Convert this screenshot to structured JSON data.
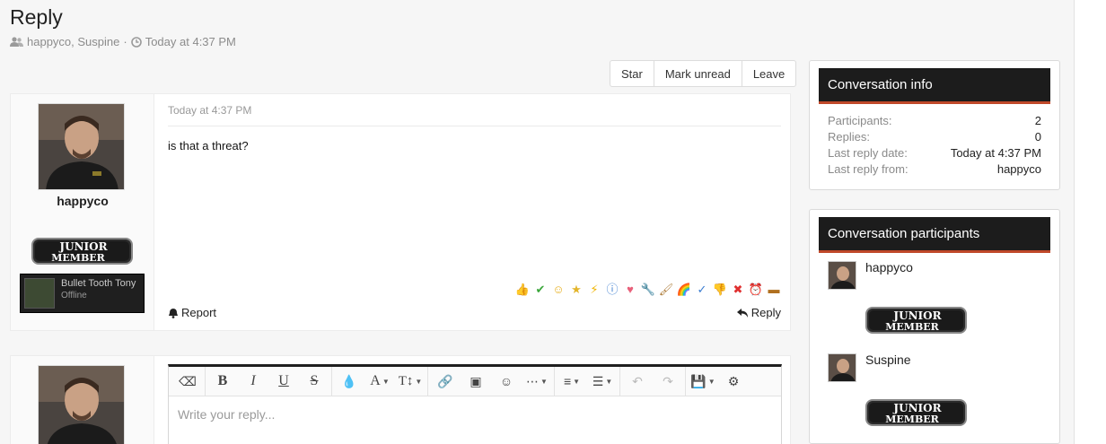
{
  "page": {
    "title": "Reply",
    "participants_line": "happyco, Suspine",
    "separator": "·",
    "date": "Today at 4:37 PM"
  },
  "actions": [
    "Star",
    "Mark unread",
    "Leave"
  ],
  "message": {
    "author": "happyco",
    "badge_line1": "JUNIOR",
    "badge_line2": "MEMBER",
    "profile_card_name": "Bullet Tooth Tony",
    "profile_card_status": "Offline",
    "date": "Today at 4:37 PM",
    "text": "is that a threat?",
    "report_label": "Report",
    "reply_label": "Reply",
    "reactions": [
      "thumbs-up",
      "check",
      "smiley",
      "star",
      "lightning",
      "info",
      "heart",
      "wrench",
      "paintbrush",
      "rainbow",
      "spellcheck",
      "thumbs-down",
      "cross",
      "alarm-clock",
      "wallet"
    ]
  },
  "editor": {
    "placeholder": "Write your reply..."
  },
  "conversation_info": {
    "title": "Conversation info",
    "rows": [
      {
        "key": "Participants:",
        "value": "2"
      },
      {
        "key": "Replies:",
        "value": "0"
      },
      {
        "key": "Last reply date:",
        "value": "Today at 4:37 PM"
      },
      {
        "key": "Last reply from:",
        "value": "happyco"
      }
    ]
  },
  "participants": {
    "title": "Conversation participants",
    "items": [
      {
        "name": "happyco",
        "badge_line1": "JUNIOR",
        "badge_line2": "MEMBER"
      },
      {
        "name": "Suspine",
        "badge_line1": "JUNIOR",
        "badge_line2": "MEMBER"
      }
    ]
  },
  "colors": {
    "block_header": "#1c1c1c",
    "accent": "#c0492a"
  }
}
